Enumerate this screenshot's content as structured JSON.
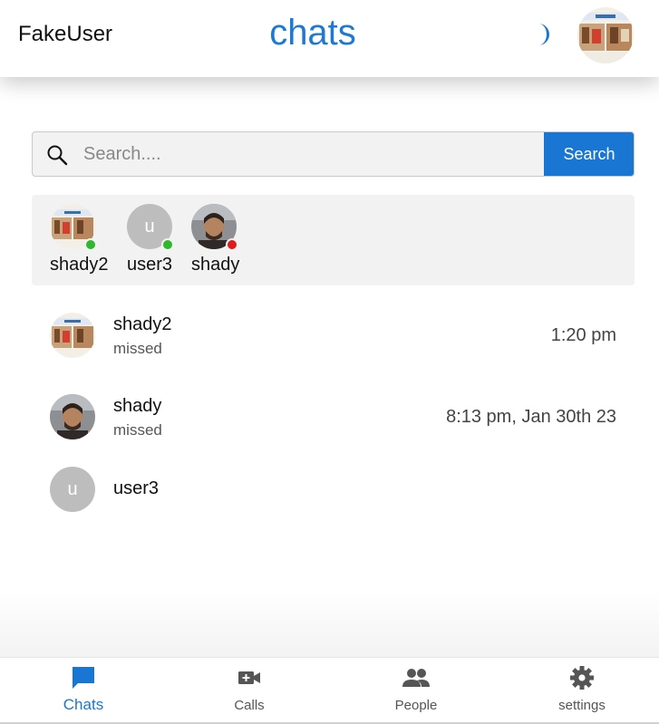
{
  "header": {
    "username": "FakeUser",
    "title": "chats",
    "theme_icon": "moon-icon",
    "avatar_icon": "profile-picture"
  },
  "search": {
    "placeholder": "Search....",
    "value": "",
    "button_label": "Search"
  },
  "online_users": [
    {
      "name": "shady2",
      "status": "online",
      "status_color": "#2db82d",
      "avatar": "photo"
    },
    {
      "name": "user3",
      "status": "online",
      "status_color": "#2db82d",
      "avatar": "u"
    },
    {
      "name": "shady",
      "status": "busy",
      "status_color": "#e01b1b",
      "avatar": "photo"
    }
  ],
  "chats": [
    {
      "name": "shady2",
      "last_message": "missed",
      "time": "1:20 pm",
      "avatar": "photo"
    },
    {
      "name": "shady",
      "last_message": "missed",
      "time": "8:13 pm, Jan 30th 23",
      "avatar": "photo"
    },
    {
      "name": "user3",
      "last_message": "",
      "time": "",
      "avatar": "u"
    }
  ],
  "bottom_nav": [
    {
      "label": "Chats",
      "icon": "chat-bubble-icon",
      "active": true
    },
    {
      "label": "Calls",
      "icon": "video-call-icon",
      "active": false
    },
    {
      "label": "People",
      "icon": "people-icon",
      "active": false
    },
    {
      "label": "settings",
      "icon": "gear-icon",
      "active": false
    }
  ],
  "colors": {
    "accent": "#1976d2",
    "title": "#1e79d2",
    "online": "#2db82d",
    "busy": "#e01b1b"
  }
}
